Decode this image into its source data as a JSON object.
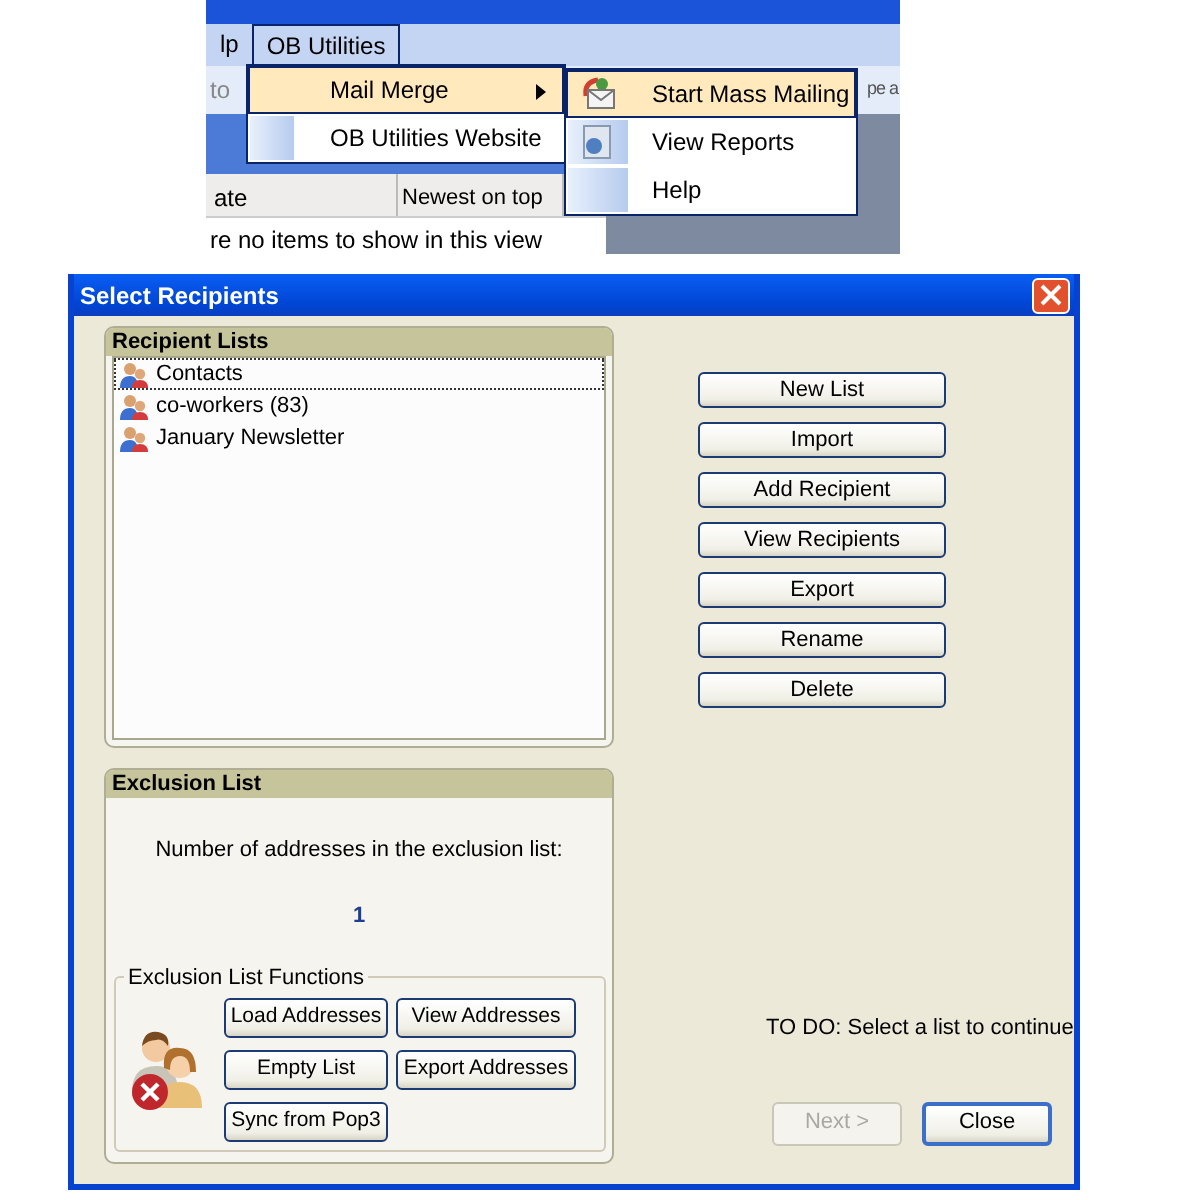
{
  "background_app": {
    "menu_bar": [
      {
        "label": "lp",
        "selected": false
      },
      {
        "label": "OB Utilities",
        "selected": true
      }
    ],
    "toolbar_fragments": [
      "to",
      "pe a"
    ],
    "columns": [
      "ate",
      "Newest on top"
    ],
    "empty_message": "re no items to show in this view"
  },
  "menu": {
    "items": [
      {
        "label": "Mail Merge",
        "selected": true,
        "submenu": true
      },
      {
        "label": "OB Utilities Website",
        "selected": false,
        "submenu": false
      }
    ]
  },
  "submenu": {
    "items": [
      {
        "label": "Start Mass Mailing",
        "selected": true,
        "kind": "mailing"
      },
      {
        "label": "View Reports",
        "selected": false,
        "kind": "reports"
      },
      {
        "label": "Help",
        "selected": false,
        "kind": "plain"
      }
    ]
  },
  "dialog": {
    "title": "Select Recipients",
    "recipient_lists": {
      "title": "Recipient Lists",
      "items": [
        {
          "label": "Contacts",
          "selected": true
        },
        {
          "label": "co-workers (83)",
          "selected": false
        },
        {
          "label": "January Newsletter",
          "selected": false
        }
      ]
    },
    "list_buttons": [
      "New List",
      "Import",
      "Add Recipient",
      "View Recipients",
      "Export",
      "Rename",
      "Delete"
    ],
    "exclusion": {
      "title": "Exclusion List",
      "caption": "Number of addresses in the exclusion list:",
      "count": "1",
      "functions_title": "Exclusion List Functions",
      "buttons": [
        "Load Addresses",
        "View Addresses",
        "Empty List",
        "Export Addresses",
        "Sync from Pop3"
      ]
    },
    "status": "TO DO: Select a list to continue",
    "footer_buttons": [
      {
        "label": "Next >",
        "disabled": true
      },
      {
        "label": "Close",
        "disabled": false
      }
    ]
  }
}
